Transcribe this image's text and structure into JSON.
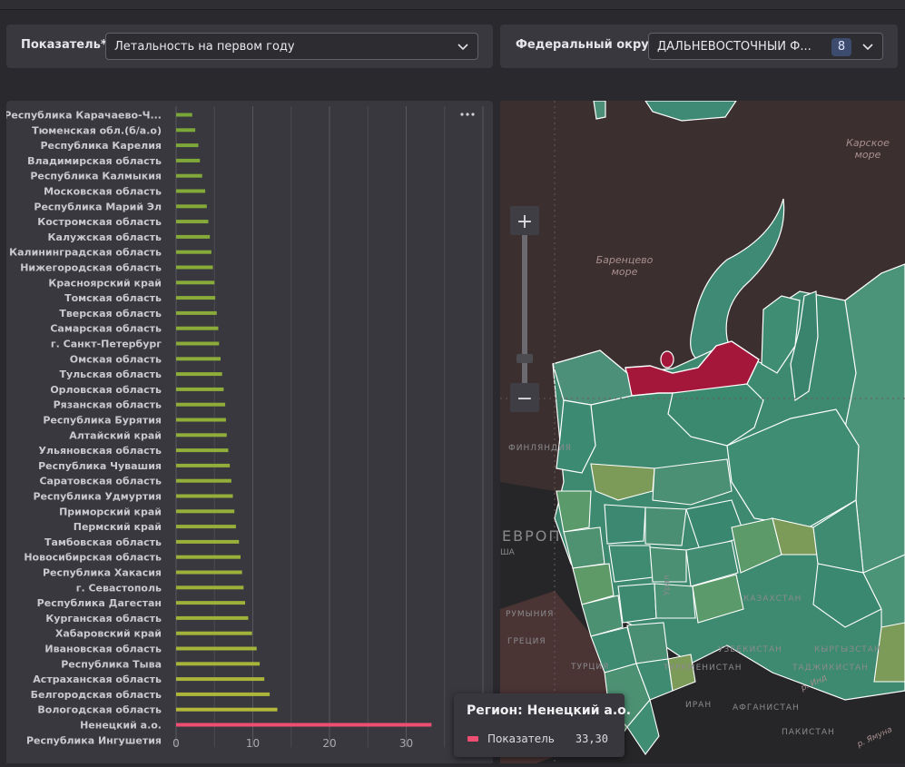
{
  "filters": {
    "indicator": {
      "label": "Показатель*",
      "value": "Летальность на первом году"
    },
    "district": {
      "label": "Федеральный округ",
      "value": "ДАЛЬНЕВОСТОЧНЫЙ Ф...",
      "count": "8"
    }
  },
  "chart": {
    "more_icon": "more-horizontal-icon",
    "chart_data": {
      "type": "bar",
      "orientation": "horizontal",
      "categories": [
        "Республика Карачаево-Ч...",
        "Тюменская обл.(б/а.о)",
        "Республика Карелия",
        "Владимирская область",
        "Республика Калмыкия",
        "Московская область",
        "Республика Марий Эл",
        "Костромская область",
        "Калужская область",
        "Калининградская область",
        "Нижегородская область",
        "Красноярский край",
        "Томская область",
        "Тверская область",
        "Самарская область",
        "г. Санкт-Петербург",
        "Омская область",
        "Тульская область",
        "Орловская область",
        "Рязанская область",
        "Республика Бурятия",
        "Алтайский край",
        "Ульяновская область",
        "Республика Чувашия",
        "Саратовская область",
        "Республика Удмуртия",
        "Приморский край",
        "Пермский край",
        "Тамбовская область",
        "Новосибирская область",
        "Республика Хакасия",
        "г. Севастополь",
        "Республика Дагестан",
        "Курганская область",
        "Хабаровский край",
        "Ивановская область",
        "Республика Тыва",
        "Астраханская область",
        "Белгородская область",
        "Вологодская область",
        "Ненецкий а.о.",
        "Республика Ингушетия"
      ],
      "values": [
        2.1,
        2.5,
        2.9,
        3.1,
        3.4,
        3.8,
        4.0,
        4.2,
        4.4,
        4.6,
        4.8,
        5.0,
        5.1,
        5.3,
        5.5,
        5.6,
        5.8,
        6.0,
        6.2,
        6.4,
        6.5,
        6.6,
        6.8,
        7.0,
        7.2,
        7.4,
        7.6,
        7.8,
        8.2,
        8.4,
        8.6,
        8.8,
        9.0,
        9.4,
        9.9,
        10.5,
        10.9,
        11.5,
        12.2,
        13.2,
        33.3,
        0
      ],
      "highlight_category": "Ненецкий а.о.",
      "xticks": [
        "0",
        "10",
        "20",
        "30"
      ],
      "xlim": [
        0,
        40
      ],
      "grid": true,
      "colors": {
        "low": "#6fa339",
        "high": "#b3b83a",
        "highlight": "#ef4e73"
      }
    }
  },
  "map": {
    "labels": {
      "kara_sea": "Карское\nморе",
      "barents_sea": "Баренцево\nморе",
      "finland": "ФИНЛЯНДИЯ",
      "europe": "ЕВРОП",
      "usa": "ША",
      "romania": "РУМЫНИЯ",
      "greece": "ГРЕЦИЯ",
      "turkey": "ТУРЦИЯ",
      "kazakhstan": "КАЗАХСТАН",
      "uzbekistan": "УЗБЕКИСТАН",
      "kyrgyzstan": "КЫРГЫЗСТАН",
      "turkmenistan": "ТУРКМЕНИСТАН",
      "tajikistan": "ТАДЖИКИСТАН",
      "iran": "ИРАН",
      "afghanistan": "АФГАНИСТАН",
      "pakistan": "ПАКИСТАН",
      "ural": "Урал",
      "india_river": "р. Инд",
      "yamuna": "р. Ямуна"
    },
    "zoom_in_label": "+",
    "zoom_out_label": "−",
    "highlighted_region": "Ненецкий а.о.",
    "colors": {
      "highlight": "#a4173a",
      "land": "#3f8d72",
      "land_light": "#5b9a6a",
      "land_pale": "#7c9b58",
      "water": "#3d2f2f",
      "outside": "#262628"
    }
  },
  "tooltip": {
    "title": "Регион: Ненецкий а.о.",
    "series_label": "Показатель",
    "value": "33,30"
  }
}
